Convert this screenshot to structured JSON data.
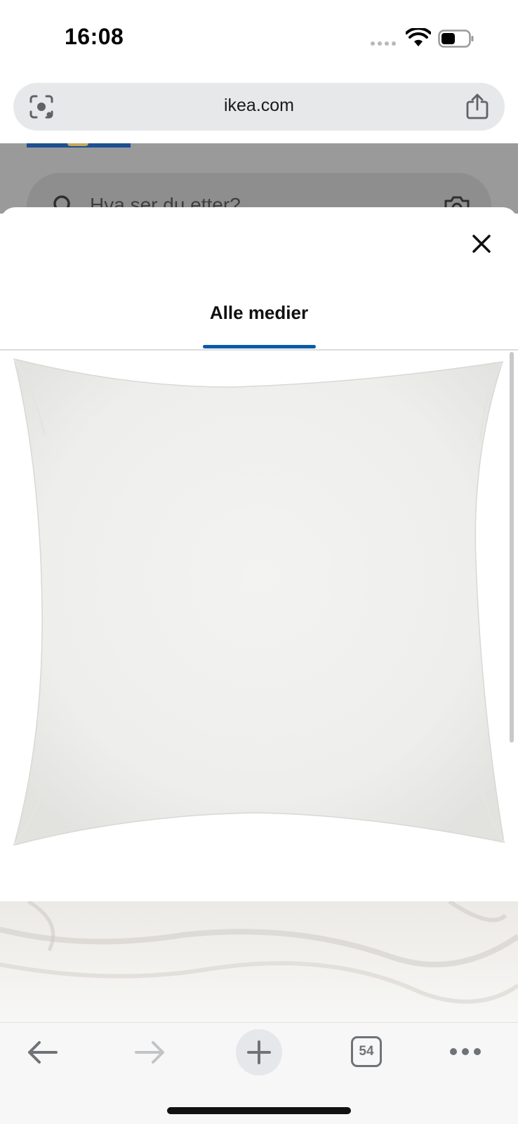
{
  "status_bar": {
    "time": "16:08"
  },
  "url_bar": {
    "url": "ikea.com"
  },
  "background_page": {
    "search_placeholder": "Hva ser du etter?"
  },
  "sheet": {
    "tabs": [
      {
        "label": "Alle medier",
        "selected": true
      }
    ],
    "media": [
      {
        "icon": "pillow-product-image"
      },
      {
        "icon": "pillow-lifestyle-image"
      }
    ]
  },
  "toolbar": {
    "tab_count": "54"
  },
  "colors": {
    "accent": "#0a5aa8",
    "ikea_blue": "#1e4f91"
  }
}
